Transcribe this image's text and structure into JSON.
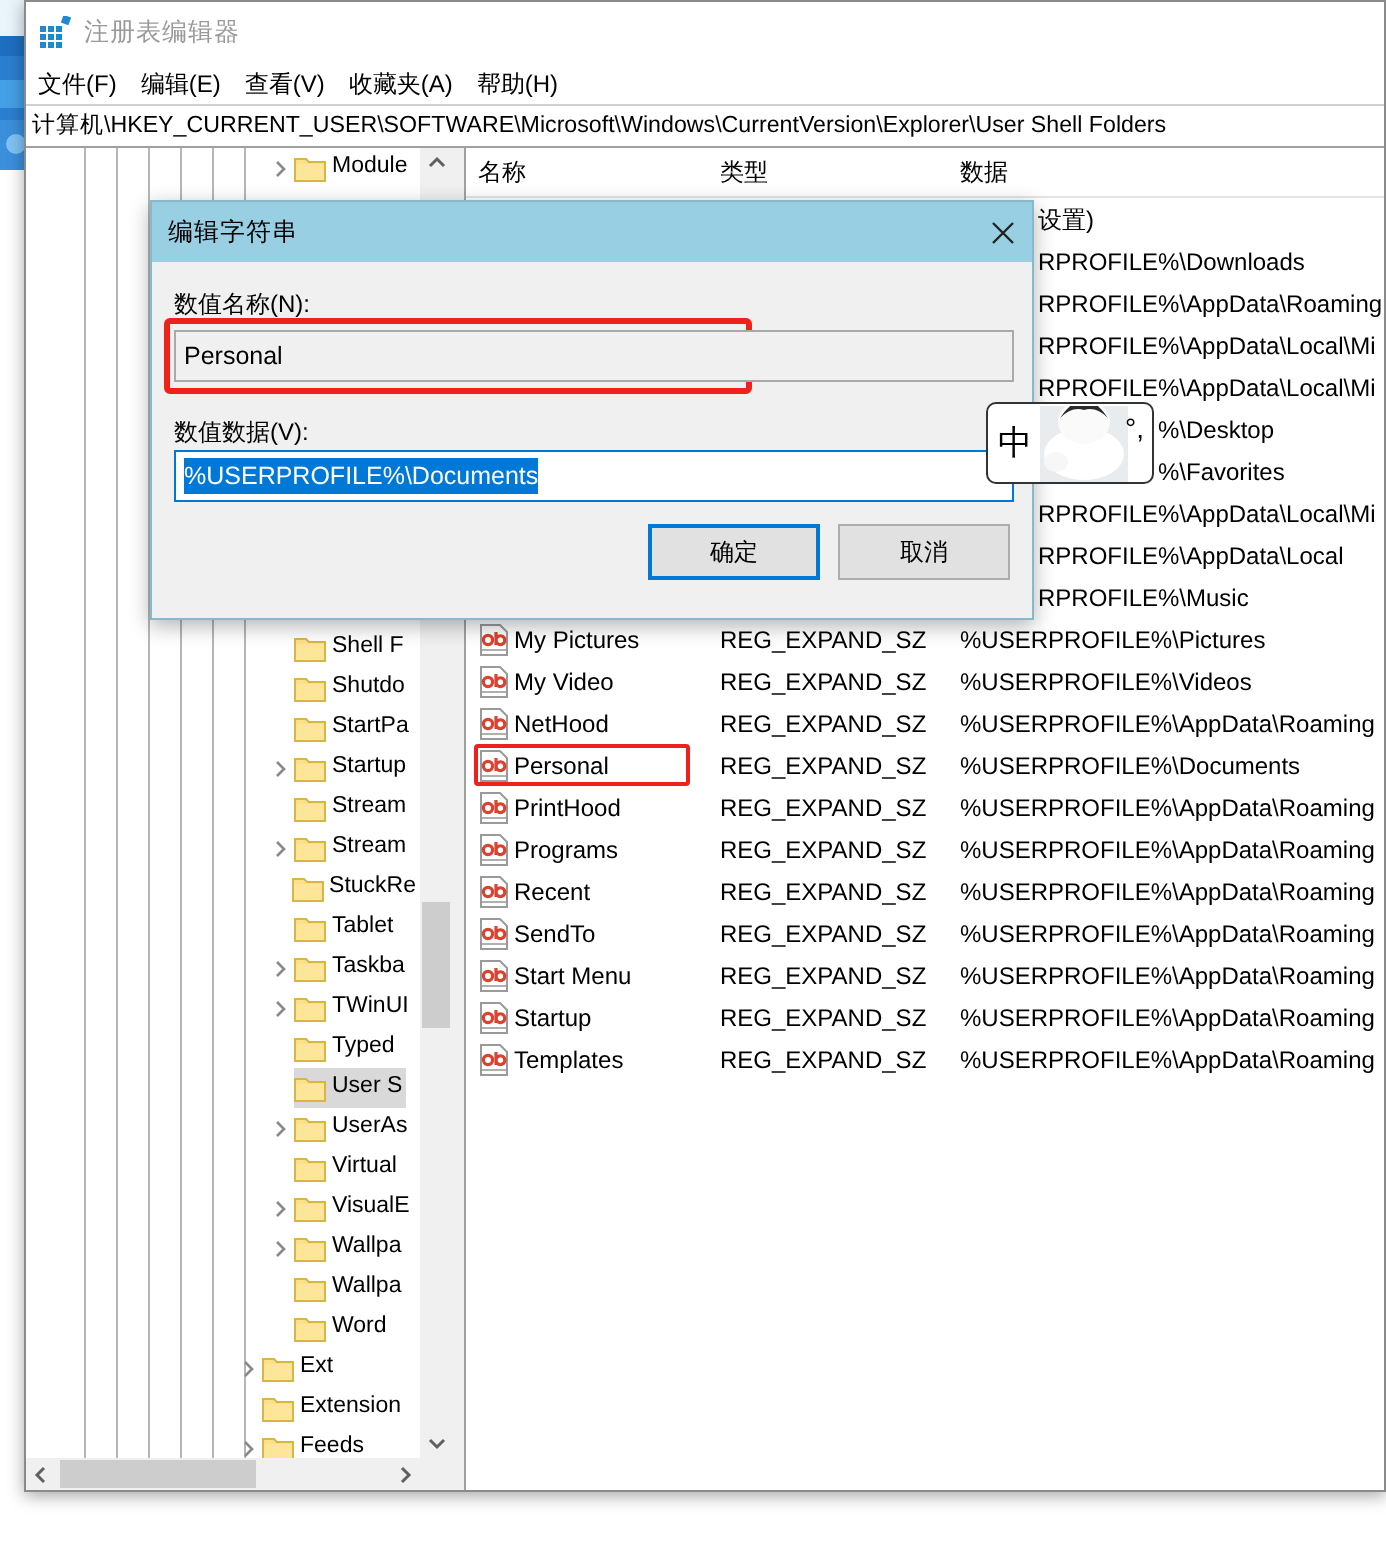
{
  "window": {
    "title": "注册表编辑器"
  },
  "menu": [
    "文件(F)",
    "编辑(E)",
    "查看(V)",
    "收藏夹(A)",
    "帮助(H)"
  ],
  "address": "计算机\\HKEY_CURRENT_USER\\SOFTWARE\\Microsoft\\Windows\\CurrentVersion\\Explorer\\User Shell Folders",
  "tree": [
    {
      "children": [
        {
          "label": "Module",
          "expandable": true,
          "selected": false
        },
        {
          "label": "Shell F",
          "expandable": false,
          "selected": false
        },
        {
          "label": "Shutdo",
          "expandable": false,
          "selected": false
        },
        {
          "label": "StartPa",
          "expandable": false,
          "selected": false
        },
        {
          "label": "Startup",
          "expandable": true,
          "selected": false
        },
        {
          "label": "Stream",
          "expandable": false,
          "selected": false
        },
        {
          "label": "Stream",
          "expandable": true,
          "selected": false
        },
        {
          "label": "StuckRe",
          "expandable": false,
          "selected": false
        },
        {
          "label": "Tablet",
          "expandable": false,
          "selected": false
        },
        {
          "label": "Taskba",
          "expandable": true,
          "selected": false
        },
        {
          "label": "TWinUI",
          "expandable": true,
          "selected": false
        },
        {
          "label": "Typed",
          "expandable": false,
          "selected": false
        },
        {
          "label": "User S",
          "expandable": false,
          "selected": true
        },
        {
          "label": "UserAs",
          "expandable": true,
          "selected": false
        },
        {
          "label": "Virtual",
          "expandable": false,
          "selected": false
        },
        {
          "label": "VisualE",
          "expandable": true,
          "selected": false
        },
        {
          "label": "Wallpa",
          "expandable": true,
          "selected": false
        },
        {
          "label": "Wallpa",
          "expandable": false,
          "selected": false
        },
        {
          "label": "Word",
          "expandable": false,
          "selected": false
        }
      ]
    },
    {
      "label": "Ext",
      "expandable": true,
      "selected": false
    },
    {
      "label": "Extension",
      "expandable": false,
      "selected": false
    },
    {
      "label": "Feeds",
      "expandable": true,
      "selected": false
    }
  ],
  "list": {
    "columns": [
      "名称",
      "类型",
      "数据"
    ],
    "rows": [
      {
        "kind": "covered",
        "data": "设置)"
      },
      {
        "kind": "covered",
        "data": "RPROFILE%\\Downloads"
      },
      {
        "kind": "covered",
        "data": "RPROFILE%\\AppData\\Roaming"
      },
      {
        "kind": "covered",
        "data": "RPROFILE%\\AppData\\Local\\Mi"
      },
      {
        "kind": "covered",
        "data": "RPROFILE%\\AppData\\Local\\Mi"
      },
      {
        "kind": "popup-covered",
        "data": "%\\Desktop"
      },
      {
        "kind": "popup-covered",
        "data": "%\\Favorites"
      },
      {
        "kind": "covered",
        "data": "RPROFILE%\\AppData\\Local\\Mi"
      },
      {
        "kind": "covered",
        "data": "RPROFILE%\\AppData\\Local"
      },
      {
        "kind": "covered",
        "data": "RPROFILE%\\Music"
      },
      {
        "kind": "full",
        "name": "My Pictures",
        "type": "REG_EXPAND_SZ",
        "data": "%USERPROFILE%\\Pictures",
        "framed": false
      },
      {
        "kind": "full",
        "name": "My Video",
        "type": "REG_EXPAND_SZ",
        "data": "%USERPROFILE%\\Videos",
        "framed": false
      },
      {
        "kind": "full",
        "name": "NetHood",
        "type": "REG_EXPAND_SZ",
        "data": "%USERPROFILE%\\AppData\\Roaming",
        "framed": false
      },
      {
        "kind": "full",
        "name": "Personal",
        "type": "REG_EXPAND_SZ",
        "data": "%USERPROFILE%\\Documents",
        "framed": true
      },
      {
        "kind": "full",
        "name": "PrintHood",
        "type": "REG_EXPAND_SZ",
        "data": "%USERPROFILE%\\AppData\\Roaming",
        "framed": false
      },
      {
        "kind": "full",
        "name": "Programs",
        "type": "REG_EXPAND_SZ",
        "data": "%USERPROFILE%\\AppData\\Roaming",
        "framed": false
      },
      {
        "kind": "full",
        "name": "Recent",
        "type": "REG_EXPAND_SZ",
        "data": "%USERPROFILE%\\AppData\\Roaming",
        "framed": false
      },
      {
        "kind": "full",
        "name": "SendTo",
        "type": "REG_EXPAND_SZ",
        "data": "%USERPROFILE%\\AppData\\Roaming",
        "framed": false
      },
      {
        "kind": "full",
        "name": "Start Menu",
        "type": "REG_EXPAND_SZ",
        "data": "%USERPROFILE%\\AppData\\Roaming",
        "framed": false
      },
      {
        "kind": "full",
        "name": "Startup",
        "type": "REG_EXPAND_SZ",
        "data": "%USERPROFILE%\\AppData\\Roaming",
        "framed": false
      },
      {
        "kind": "full",
        "name": "Templates",
        "type": "REG_EXPAND_SZ",
        "data": "%USERPROFILE%\\AppData\\Roaming",
        "framed": false
      }
    ]
  },
  "dialog": {
    "title": "编辑字符串",
    "name_label": "数值名称(N):",
    "name_value": "Personal",
    "name_framed": true,
    "data_label": "数值数据(V):",
    "data_value": "%USERPROFILE%\\Documents",
    "data_text_selected": true,
    "buttons": [
      {
        "label": "确定",
        "default": true
      },
      {
        "label": "取消",
        "default": false
      }
    ]
  },
  "ime": {
    "mode": "中",
    "punctuation": "°,"
  }
}
